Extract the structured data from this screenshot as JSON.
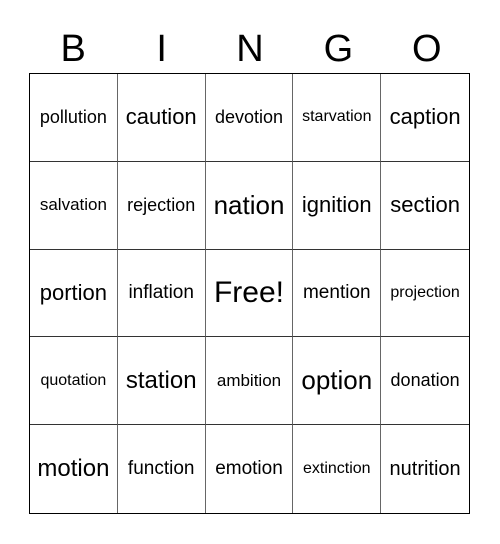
{
  "header": {
    "letters": [
      "B",
      "I",
      "N",
      "G",
      "O"
    ]
  },
  "grid": {
    "rows": [
      [
        "pollution",
        "caution",
        "devotion",
        "starvation",
        "caption"
      ],
      [
        "salvation",
        "rejection",
        "nation",
        "ignition",
        "section"
      ],
      [
        "portion",
        "inflation",
        "Free!",
        "mention",
        "projection"
      ],
      [
        "quotation",
        "station",
        "ambition",
        "option",
        "donation"
      ],
      [
        "motion",
        "function",
        "emotion",
        "extinction",
        "nutrition"
      ]
    ]
  }
}
